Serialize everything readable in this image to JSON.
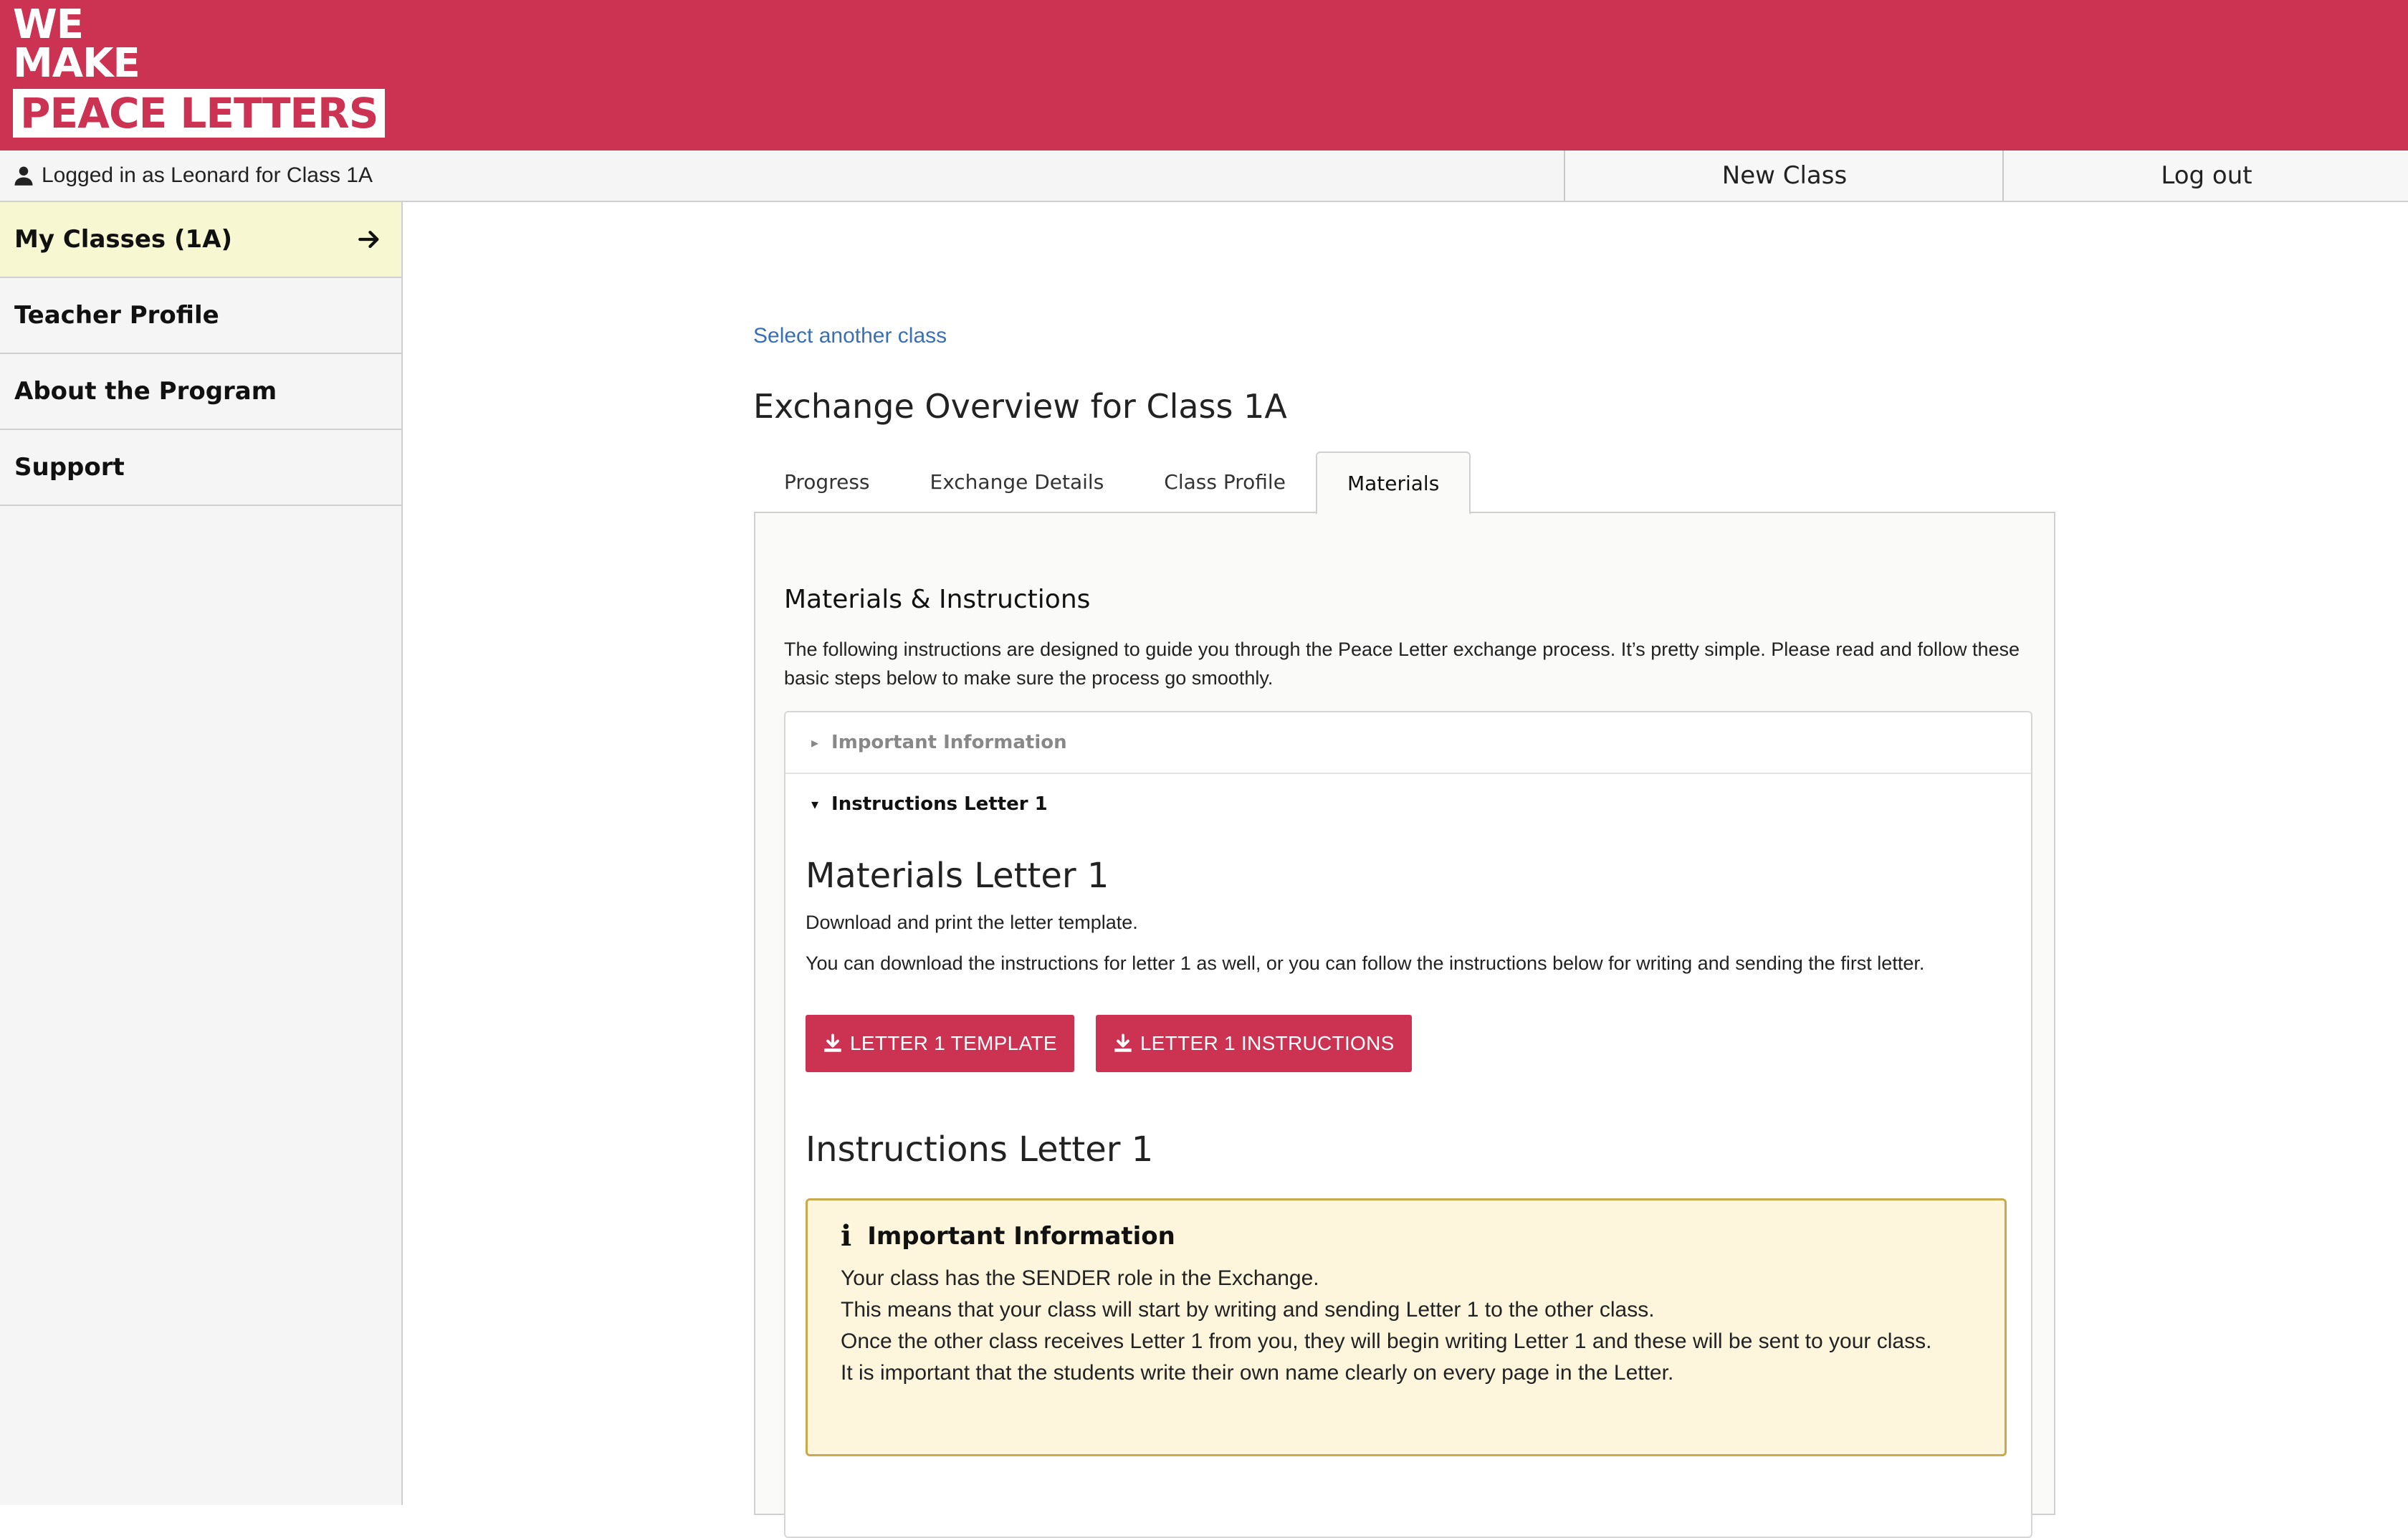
{
  "brand": {
    "line1": "WE",
    "line2": "MAKE",
    "line3": "PEACE LETTERS",
    "color": "#cc3352"
  },
  "topbar": {
    "logged_in_text": "Logged in as Leonard for Class 1A",
    "new_class_label": "New Class",
    "logout_label": "Log out"
  },
  "sidebar": {
    "items": [
      {
        "label": "My Classes (1A)",
        "active": true
      },
      {
        "label": "Teacher Profile"
      },
      {
        "label": "About the Program"
      },
      {
        "label": "Support"
      }
    ]
  },
  "main": {
    "select_link": "Select another class",
    "title": "Exchange Overview for Class 1A",
    "tabs": [
      "Progress",
      "Exchange Details",
      "Class Profile",
      "Materials"
    ],
    "active_tab": "Materials",
    "section_title": "Materials & Instructions",
    "intro": "The following instructions are designed to guide you through the Peace Letter exchange process. It’s pretty simple. Please read and follow these basic steps below to make sure the process go smoothly.",
    "accordion": {
      "collapsed_label": "Important Information",
      "expanded_label": "Instructions Letter 1",
      "materials_heading": "Materials Letter 1",
      "download_text": "Download and print the letter template.",
      "instructions_text": "You can download the instructions for letter 1 as well, or you can follow the instructions below for writing and sending the first letter.",
      "buttons": [
        "LETTER 1 TEMPLATE",
        "LETTER 1 INSTRUCTIONS"
      ],
      "instructions_heading": "Instructions Letter 1",
      "info_box": {
        "title": "Important Information",
        "lines": [
          "Your class has the SENDER role in the Exchange.",
          "This means that your class will start by writing and sending Letter 1 to the other class.",
          "Once the other class receives Letter 1 from you, they will begin writing Letter 1 and these will be sent to your class.",
          "It is important that the students write their own name clearly on every page in the Letter."
        ]
      }
    }
  }
}
